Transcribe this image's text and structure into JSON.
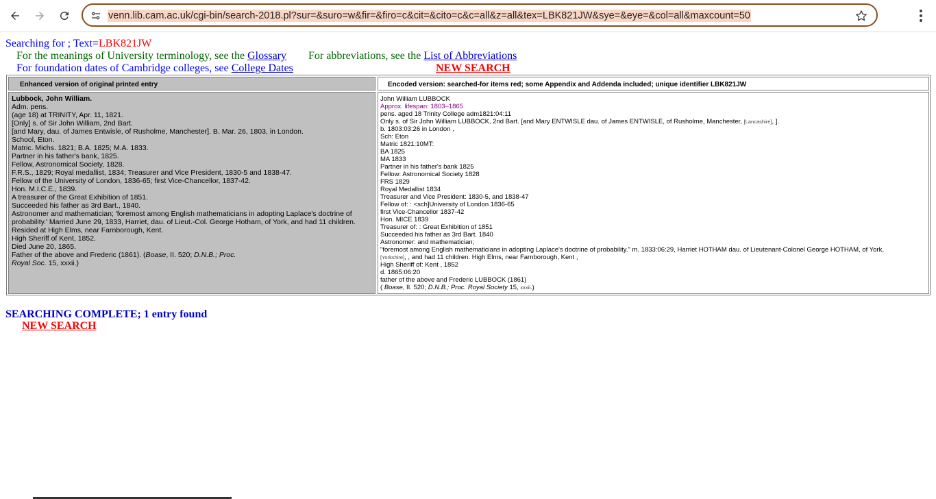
{
  "browser": {
    "url": "venn.lib.cam.ac.uk/cgi-bin/search-2018.pl?sur=&suro=w&fir=&firo=c&cit=&cito=c&c=all&z=all&tex=LBK821JW&sye=&eye=&col=all&maxcount=50",
    "icons": {
      "back": "back-arrow-icon",
      "forward": "forward-arrow-icon",
      "reload": "reload-icon",
      "site_info": "site-info-icon",
      "bookmark": "star-icon",
      "menu": "more-vert-icon"
    }
  },
  "header": {
    "searching_prefix": "Searching for ; Text=",
    "search_term": "LBK821JW",
    "glossary_prefix": "For the meanings of University terminology, see the ",
    "glossary_link": "Glossary",
    "abbrev_prefix": "For abbreviations, see the ",
    "abbrev_link": "List of Abbreviations",
    "dates_prefix": "For foundation dates of Cambridge colleges, see ",
    "dates_link": "College Dates",
    "new_search": "NEW SEARCH"
  },
  "results": {
    "left_header": "Enhanced version of original printed entry",
    "right_header": "Encoded version: searched-for items red; some Appendix and Addenda included; unique identifier LBK821JW",
    "left_name": "Lubbock, John William.",
    "left_lines": [
      "Adm. pens.",
      "(age 18) at TRINITY, Apr. 11, 1821.",
      "[Only] s. of Sir John William, 2nd Bart.",
      "[and Mary, dau. of James Entwisle, of Rusholme, Manchester]. B. Mar. 26, 1803, in London.",
      "School, Eton.",
      "Matric. Michs. 1821; B.A. 1825; M.A. 1833.",
      "Partner in his father's bank, 1825.",
      "Fellow, Astronomical Society, 1828.",
      "F.R.S., 1829; Royal medallist, 1834; Treasurer and Vice President, 1830-5 and 1838-47.",
      "Fellow of the University of London, 1836-65; first Vice-Chancellor, 1837-42.",
      "Hon. M.I.C.E., 1839.",
      "A treasurer of the Great Exhibition of 1851.",
      "Succeeded his father as 3rd Bart., 1840.",
      "Astronomer and mathematician; 'foremost among English mathematicians in adopting Laplace's doctrine of",
      "probability.' Married June 29, 1833, Harriet, dau. of Lieut.-Col. George Hotham, of York, and had 11 children.",
      "Resided at High Elms, near Farnborough, Kent.",
      "High Sheriff of Kent, 1852.",
      "Died June 20, 1865."
    ],
    "left_father": "Father of the above and Frederic (1861). (",
    "left_ref_a": "Boase",
    "left_ref_b": ", II. 520; ",
    "left_ref_c": "D.N.B.; Proc.",
    "left_ref_d": "Royal Soc.",
    "left_ref_e": " 15, xxxii.)",
    "right_name": "John William LUBBOCK",
    "right_lifespan": "Approx. lifespan: 1803–1865",
    "right_line_pens": "pens. aged 18 Trinity College adm1821:04:11",
    "right_line_only": "Only s. of Sir John William LUBBOCK, 2nd Bart. [and Mary ENTWISLE dau. of James ENTWISLE, of Rusholme, Manchester, ",
    "right_lancs": "[Lancashire]",
    "right_line_only_end": ", ].",
    "right_lines_a": [
      "b. 1803:03:26 in London ,",
      "Sch: Eton",
      "Matric 1821:10MT:",
      "BA 1825",
      "MA 1833",
      "Partner in his father's bank 1825",
      "Fellow: Astronomical Society 1828",
      "FRS 1829",
      "Royal Medallist 1834",
      "Treasurer and Vice President: 1830-5, and 1838-47",
      "Fellow of: : <sch]University of London 1836-65",
      "first Vice-Chancellor 1837-42",
      "Hon. MICE 1839",
      "Treasurer of: : Great Exhibition of 1851",
      "Succeeded his father as 3rd Bart. 1840",
      "Astronomer: and mathematician;"
    ],
    "right_line_foremost": "\"foremost among English mathematicians in adopting Laplace's doctrine of probability.\" m. 1833:06:29, Harriet HOTHAM dau. of Lieutenant-Colonel George HOTHAM, of York,",
    "right_yorks": "[Yorkshire]",
    "right_line_children": ", , and had 11 children. High Elms, near Farnborough, Kent ,",
    "right_lines_b": [
      "High Sheriff of: Kent , 1852",
      "d. 1865:06:20",
      "father of the above and Frederic LUBBOCK (1861)"
    ],
    "right_ref_open": "( ",
    "right_ref_a": "Boase",
    "right_ref_b": ", II. 520; ",
    "right_ref_c": "D.N.B.; Proc. Royal Society",
    "right_ref_d": " 15, ",
    "right_ref_e": "xxxii",
    "right_ref_f": ".)"
  },
  "footer": {
    "complete": "SEARCHING COMPLETE; 1 entry found",
    "new_search": "NEW SEARCH"
  }
}
